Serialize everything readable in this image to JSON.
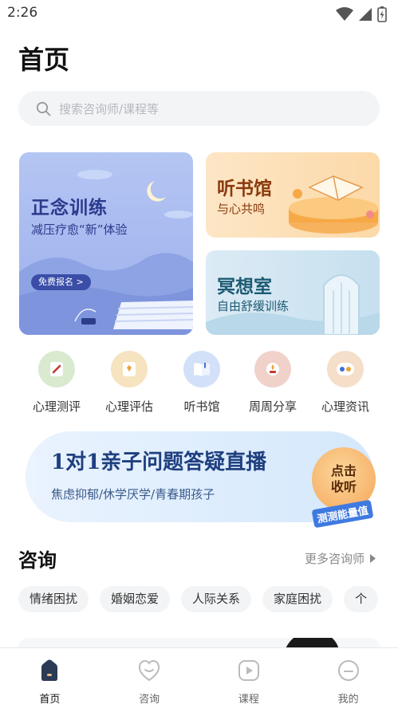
{
  "status_bar": {
    "time": "2:26"
  },
  "page_title": "首页",
  "search": {
    "placeholder": "搜索咨询师/课程等"
  },
  "cards": {
    "mindfulness": {
      "title": "正念训练",
      "subtitle": "减压疗愈“新”体验",
      "button": "免费报名 >"
    },
    "book": {
      "title": "听书馆",
      "subtitle": "与心共鸣"
    },
    "meditation": {
      "title": "冥想室",
      "subtitle": "自由舒缓训练"
    }
  },
  "categories": [
    {
      "label": "心理测评",
      "icon": "test-icon",
      "color": "#cfe3c4"
    },
    {
      "label": "心理评估",
      "icon": "assessment-icon",
      "color": "#f6e0b6"
    },
    {
      "label": "听书馆",
      "icon": "book-icon",
      "color": "#c9d9f6"
    },
    {
      "label": "周周分享",
      "icon": "share-icon",
      "color": "#f0cdc6"
    },
    {
      "label": "心理资讯",
      "icon": "news-icon",
      "color": "#f4dcc4"
    }
  ],
  "banner": {
    "title": "1对1亲子问题答疑直播",
    "subtitle": "焦虑抑郁/休学厌学/青春期孩子",
    "cta_line1": "点击",
    "cta_line2": "收听",
    "tag": "测测能量值"
  },
  "consult": {
    "heading": "咨询",
    "more": "更多咨询师",
    "chips": [
      "情绪困扰",
      "婚姻恋爱",
      "人际关系",
      "家庭困扰",
      "个"
    ]
  },
  "tabs": [
    {
      "label": "首页",
      "icon": "home-icon",
      "active": true
    },
    {
      "label": "咨询",
      "icon": "heart-chat-icon",
      "active": false
    },
    {
      "label": "课程",
      "icon": "play-icon",
      "active": false
    },
    {
      "label": "我的",
      "icon": "profile-icon",
      "active": false
    }
  ],
  "colors": {
    "accent": "#2a3a8c",
    "chip_bg": "#f3f4f6"
  }
}
